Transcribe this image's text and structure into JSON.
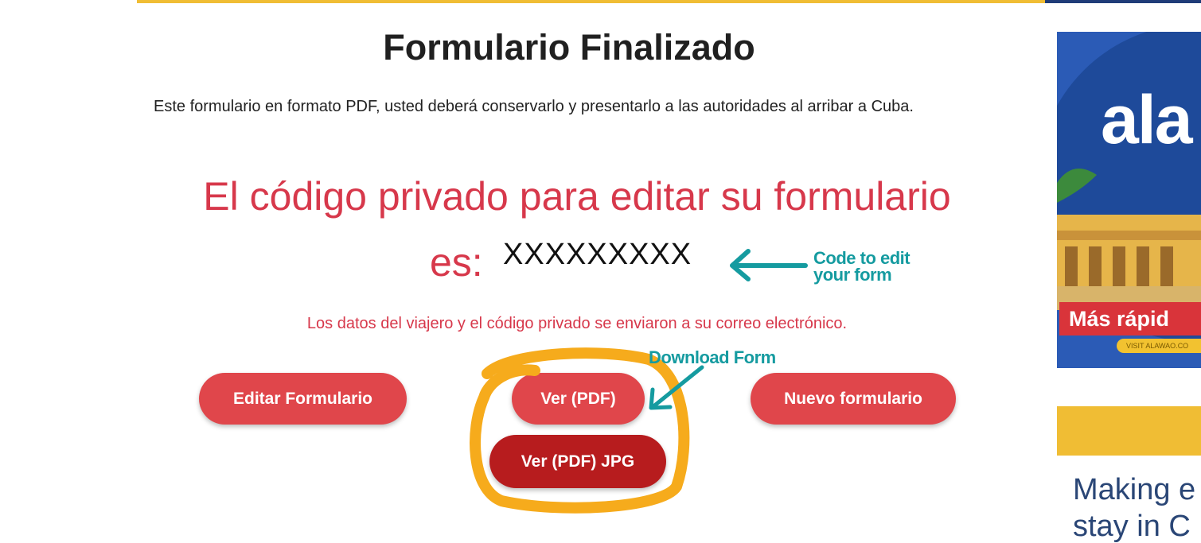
{
  "main": {
    "title": "Formulario Finalizado",
    "intro": "Este formulario en formato PDF, usted deberá conservarlo y presentarlo a las autoridades al arribar a Cuba.",
    "code_heading": "El código privado para editar su formulario",
    "code_prefix": "es:",
    "code_value": "XXXXXXXXX",
    "sent_note": "Los datos del viajero y el código privado se enviaron a su correo electrónico."
  },
  "buttons": {
    "edit_label": "Editar Formulario",
    "view_pdf_label": "Ver (PDF)",
    "new_label": "Nuevo formulario",
    "view_jpg_label": "Ver (PDF) JPG"
  },
  "annotations": {
    "code_note": "Code to edit your form",
    "download_note": "Download Form",
    "color": "#159ba0",
    "highlight_color": "#f6ab1c"
  },
  "sidebar": {
    "ad_top": {
      "logo_text": "ala",
      "banner_text": "Más rápid",
      "visit_text": "VISIT ALAWAO.CO"
    },
    "ad_bottom": {
      "tagline": "Making e\nstay in C"
    }
  },
  "colors": {
    "accent_red": "#e0464b",
    "dark_red": "#b71c1e",
    "heading_red": "#d7384b",
    "brand_yellow": "#f0bd34",
    "brand_blue": "#1e4a9a"
  },
  "icons": [
    "arrow-left-icon",
    "arrow-down-left-icon",
    "highlight-circle"
  ]
}
